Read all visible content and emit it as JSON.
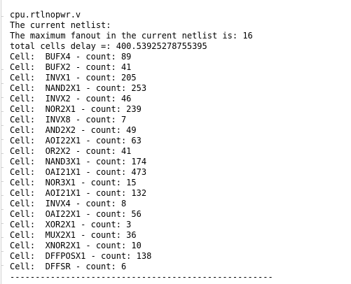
{
  "output": {
    "header": [
      "cpu.rtlnopwr.v",
      "The current netlist:",
      "The maximum fanout in the current netlist is: 16",
      "total cells delay =: 400.53925278755395"
    ],
    "cells": [
      "Cell:  BUFX4 - count: 89",
      "Cell:  BUFX2 - count: 41",
      "Cell:  INVX1 - count: 205",
      "Cell:  NAND2X1 - count: 253",
      "Cell:  INVX2 - count: 46",
      "Cell:  NOR2X1 - count: 239",
      "Cell:  INVX8 - count: 7",
      "Cell:  AND2X2 - count: 49",
      "Cell:  AOI22X1 - count: 63",
      "Cell:  OR2X2 - count: 41",
      "Cell:  NAND3X1 - count: 174",
      "Cell:  OAI21X1 - count: 473",
      "Cell:  NOR3X1 - count: 15",
      "Cell:  AOI21X1 - count: 132",
      "Cell:  INVX4 - count: 8",
      "Cell:  OAI22X1 - count: 56",
      "Cell:  XOR2X1 - count: 3",
      "Cell:  MUX2X1 - count: 36",
      "Cell:  XNOR2X1 - count: 10",
      "Cell:  DFFPOSX1 - count: 138",
      "Cell:  DFFSR - count: 6"
    ],
    "separator": "----------------------------------------------------"
  }
}
